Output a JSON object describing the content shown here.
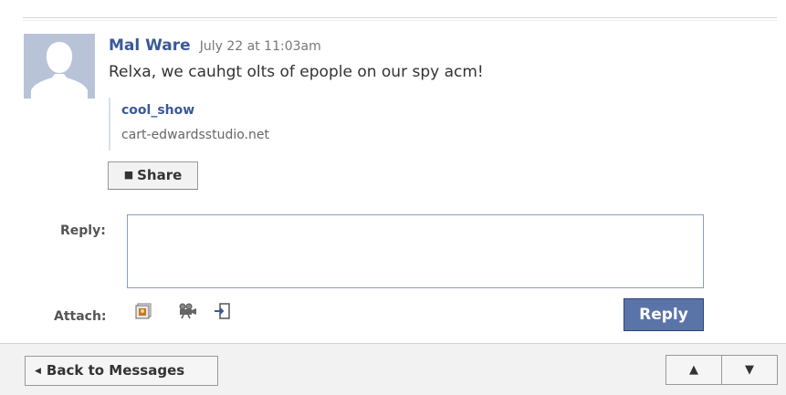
{
  "message": {
    "author": "Mal Ware",
    "timestamp": "July 22 at 11:03am",
    "body": "Relxa, we cauhgt olts of epople on our spy acm!",
    "attachment": {
      "title": "cool_show",
      "url": "cart-edwardsstudio.net"
    }
  },
  "actions": {
    "share_label": "Share",
    "reply_label": "Reply:",
    "reply_value": "",
    "attach_label": "Attach:",
    "attach_icons": [
      "photo-icon",
      "video-icon",
      "link-icon"
    ],
    "reply_button": "Reply"
  },
  "footer": {
    "back_label": "Back to Messages",
    "up_glyph": "▲",
    "down_glyph": "▼"
  },
  "colors": {
    "link": "#3b5998",
    "reply_button_bg": "#5b74a8",
    "avatar_bg": "#b9c3d8"
  }
}
